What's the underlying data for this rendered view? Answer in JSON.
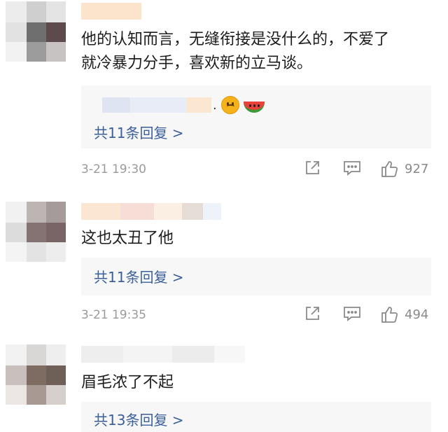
{
  "comments": [
    {
      "text_lines": [
        "他的认知而言，无缝衔接是没什么的，不爱了",
        "就冷暴力分手，喜欢新的立马谈。"
      ],
      "reply_preview_suffix": ".",
      "reply_link": "共11条回复 >",
      "time": "3-21 19:30",
      "likes": "927"
    },
    {
      "text_lines": [
        "这也太丑了他"
      ],
      "reply_link": "共11条回复 >",
      "time": "3-21 19:35",
      "likes": "494"
    },
    {
      "text_lines": [
        "眉毛浓了不起"
      ],
      "reply_link": "共13条回复 >"
    }
  ],
  "icons": {
    "share": "share-icon",
    "comment": "comment-icon",
    "like": "thumbs-up-icon",
    "emoji1": "upside-down-face-emoji",
    "emoji2": "watermelon-emoji"
  },
  "colors": {
    "link": "#3a5f9a",
    "meta": "#9a9a9a",
    "reply_bg": "#f7f7f7"
  }
}
